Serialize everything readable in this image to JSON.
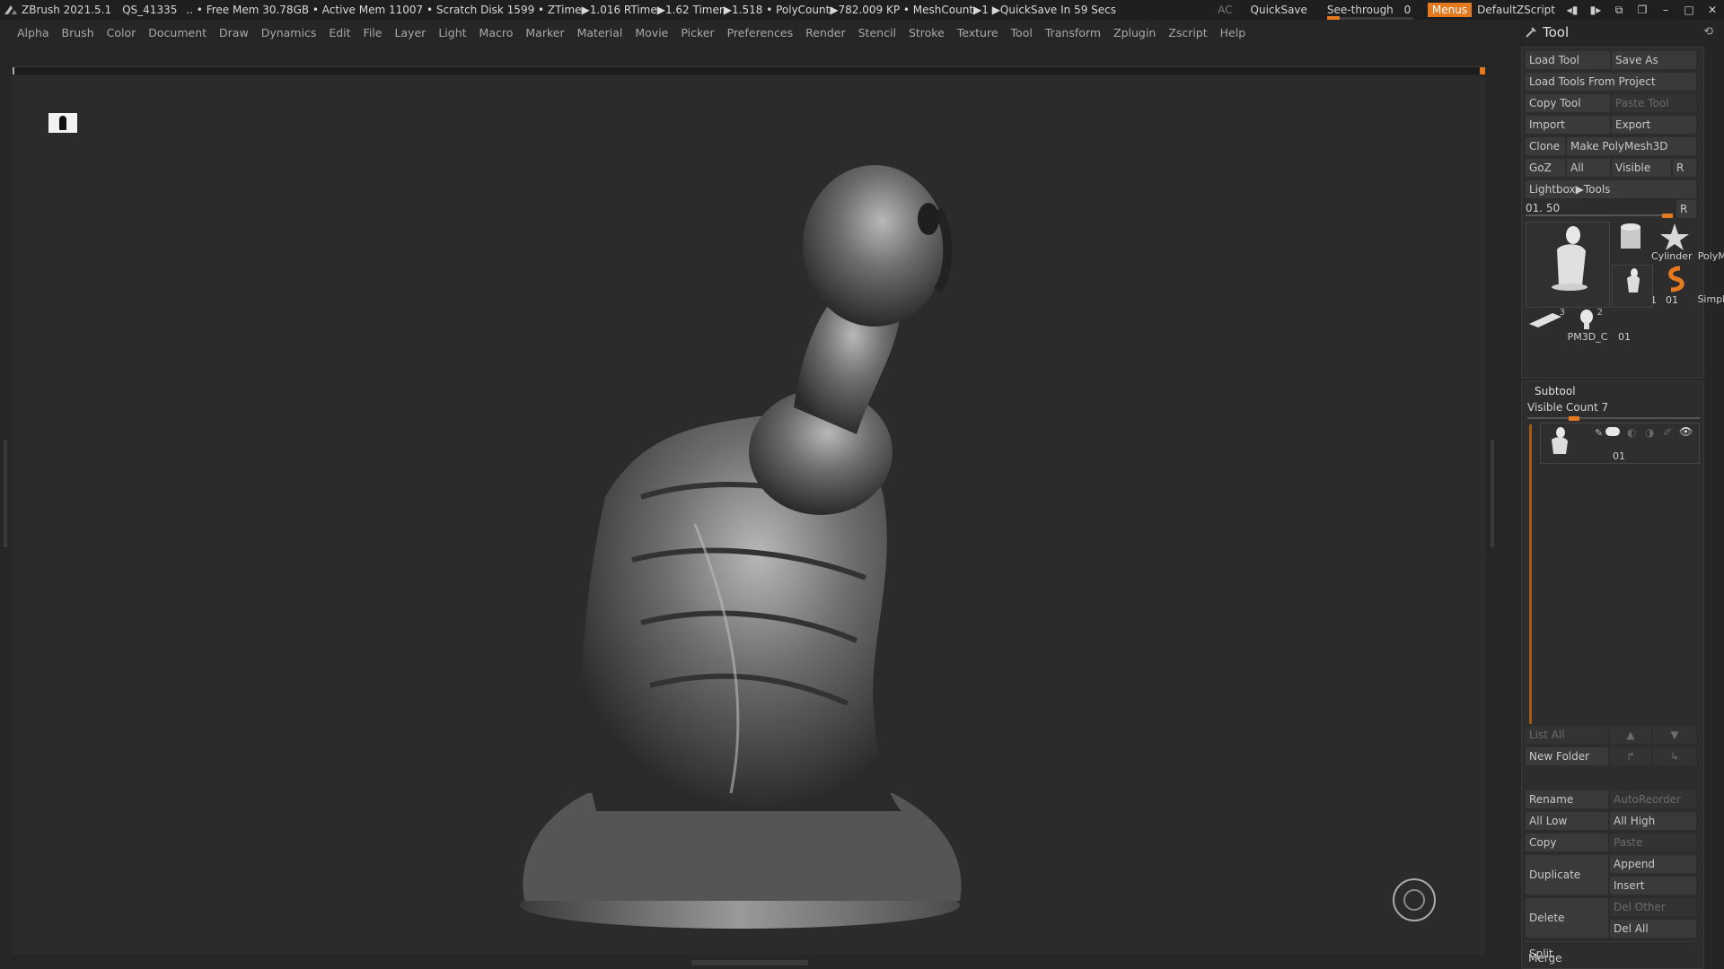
{
  "titlebar": {
    "app": "ZBrush 2021.5.1",
    "doc": "QS_41335",
    "status": ".. • Free Mem 30.78GB • Active Mem 11007 • Scratch Disk 1599 • ZTime▶1.016 RTime▶1.62 Timer▶1.518 • PolyCount▶782.009 KP • MeshCount▶1 ▶QuickSave In 59 Secs",
    "ac": "AC",
    "quicksave": "QuickSave",
    "seethrough": "See-through",
    "seethrough_value": "0",
    "menus": "Menus",
    "script": "DefaultZScript",
    "accent": "#e4791f"
  },
  "menubar": [
    "Alpha",
    "Brush",
    "Color",
    "Document",
    "Draw",
    "Dynamics",
    "Edit",
    "File",
    "Layer",
    "Light",
    "Macro",
    "Marker",
    "Material",
    "Movie",
    "Picker",
    "Preferences",
    "Render",
    "Stencil",
    "Stroke",
    "Texture",
    "Tool",
    "Transform",
    "Zplugin",
    "Zscript",
    "Help"
  ],
  "tool": {
    "title": "Tool",
    "load_tool": "Load Tool",
    "save_as": "Save As",
    "load_from_project": "Load Tools From Project",
    "copy_tool": "Copy Tool",
    "paste_tool": "Paste Tool",
    "import": "Import",
    "export": "Export",
    "clone": "Clone",
    "make_polymesh": "Make PolyMesh3D",
    "goz": "GoZ",
    "all": "All",
    "visible": "Visible",
    "r": "R",
    "lightbox": "Lightbox▶Tools",
    "slider_value": "01. 50",
    "thumbs": {
      "main": "01",
      "cylinder": "Cylinder",
      "polymesh": "PolyMes",
      "small01": "01",
      "simpleb": "SimpleB",
      "pm3d": "PM3D_C",
      "pm3d_count": "3",
      "head01": "01",
      "head_count": "2"
    }
  },
  "subtool": {
    "title": "Subtool",
    "visible_count": "Visible Count 7",
    "item_label": "01",
    "list_all": "List All",
    "new_folder": "New Folder",
    "rename": "Rename",
    "autoreorder": "AutoReorder",
    "all_low": "All Low",
    "all_high": "All High",
    "copy": "Copy",
    "paste": "Paste",
    "duplicate": "Duplicate",
    "append": "Append",
    "insert": "Insert",
    "delete": "Delete",
    "del_other": "Del Other",
    "del_all": "Del All",
    "split": "Split",
    "merge": "Merge"
  }
}
